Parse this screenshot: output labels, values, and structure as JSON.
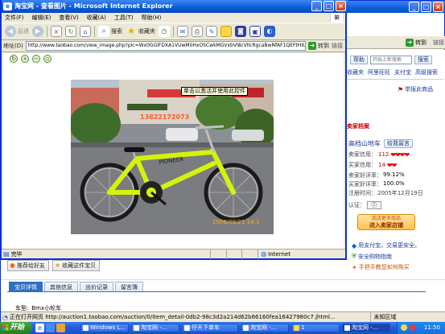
{
  "background_window": {
    "address_go": "转到",
    "links": "链接",
    "right_panel": {
      "help_button": "帮助",
      "search_placeholder": "开始上新搜索",
      "search_button": "搜索",
      "nav_links": [
        "收藏夹",
        "阿里旺旺",
        "支付宝",
        "高级搜索"
      ],
      "report_link": "举报此商品",
      "seller_archive_title": "卖家档案",
      "seller_name": "高档山地车",
      "give_message_button": "给我留言",
      "seller_credit_label": "卖家信用：",
      "seller_credit_value": "112",
      "buyer_credit_label": "买家信用：",
      "buyer_credit_value": "14",
      "seller_good_rate_label": "卖家好评率：",
      "seller_good_rate_value": "99.12%",
      "buyer_good_rate_label": "买家好评率：",
      "buyer_good_rate_value": "100.0%",
      "register_label": "注册时间：",
      "register_value": "2005年12月19日",
      "verify_label": "认证：",
      "shop_button_line1": "我店更多商品",
      "shop_button_line2": "进入卖家店铺",
      "alipay_text": "用支付宝，交易更安全。",
      "safe_shopping": "安全购物指南",
      "phone_guide": "手把手教您如何购买"
    },
    "actions": {
      "recommend": "推荐给好友",
      "favorite": "收藏这件宝贝"
    },
    "tabs": [
      "宝贝详情",
      "其他信息",
      "出价记录",
      "留言簿"
    ],
    "car_type_label": "车型:",
    "car_type_value": "Bmx小轮车",
    "status_text": "正在打开网页 http://auction1.taobao.com/auction/0/item_detail-0db2-98c3d2a214d62b66160fea16427980c7.jhtml...",
    "status_zone": "未知区域"
  },
  "popup": {
    "title": "淘宝网 - 查看图片 - Microsoft Internet Explorer",
    "menu": [
      "文件(F)",
      "编辑(E)",
      "查看(V)",
      "收藏(A)",
      "工具(T)",
      "帮助(H)"
    ],
    "toolbar": {
      "back": "后退",
      "search": "搜索",
      "favorites": "收藏夹"
    },
    "address_label": "地址(D)",
    "address_value": "http://www.taobao.com/view_image.php?pic=Wx0GGlFDXA1VUwM0HxOSCwkMGVxbVl8cVllcRgcaBwNfAF1QEFtHXAVU",
    "go_label": "转到",
    "links_label": "链接",
    "photo_tooltip": "单击以激活并使用此控件",
    "photo_date_stamp": "2006/08/21  14:3",
    "photo_watermark": "13822172073",
    "status_left": "完毕",
    "status_zone": "Internet"
  },
  "taskbar": {
    "start": "开始",
    "tasks": [
      "Windows L...",
      "淘宝网 -...",
      "仔天下单车",
      "淘宝网 -...",
      "1",
      "淘宝网 -..."
    ],
    "clock": "11:50"
  }
}
